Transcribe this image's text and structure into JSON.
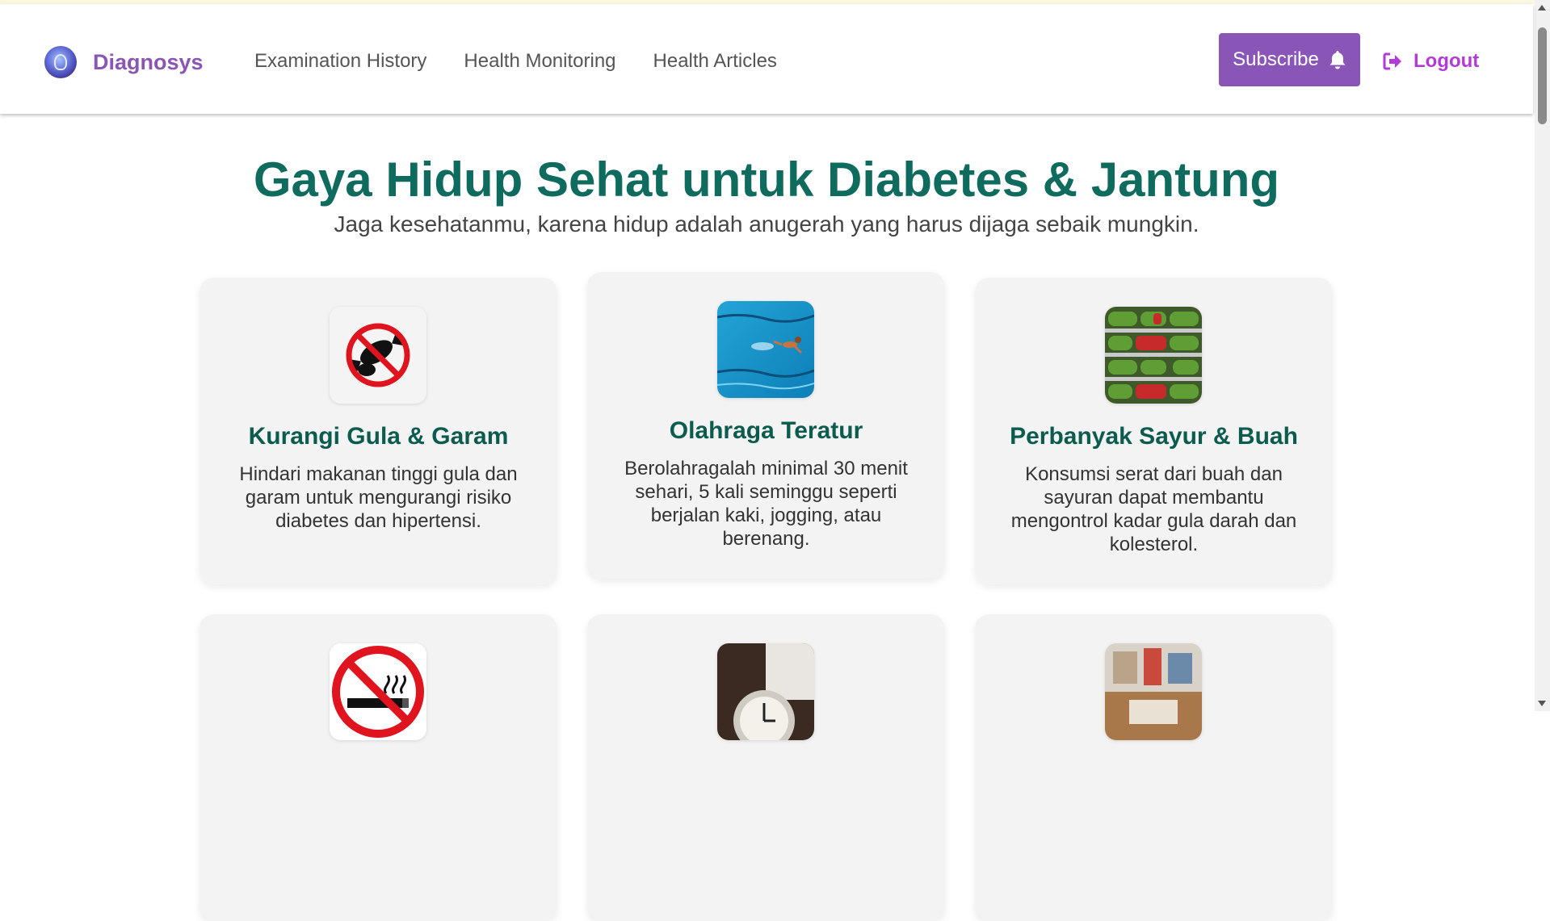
{
  "navbar": {
    "brand": "Diagnosys",
    "links": [
      "Examination History",
      "Health Monitoring",
      "Health Articles"
    ],
    "subscribe_label": "Subscribe",
    "logout_label": "Logout"
  },
  "hero": {
    "title": "Gaya Hidup Sehat untuk Diabetes & Jantung",
    "subtitle": "Jaga kesehatanmu, karena hidup adalah anugerah yang harus dijaga sebaik mungkin."
  },
  "cards": [
    {
      "icon": "no-candy-icon",
      "title": "Kurangi Gula & Garam",
      "text": "Hindari makanan tinggi gula dan garam untuk mengurangi risiko diabetes dan hipertensi."
    },
    {
      "icon": "swimming-photo",
      "title": "Olahraga Teratur",
      "text": "Berolahragalah minimal 30 menit sehari, 5 kali seminggu seperti berjalan kaki, jogging, atau berenang."
    },
    {
      "icon": "vegetables-photo",
      "title": "Perbanyak Sayur & Buah",
      "text": "Konsumsi serat dari buah dan sayuran dapat membantu mengontrol kadar gula darah dan kolesterol."
    },
    {
      "icon": "no-smoking-icon"
    },
    {
      "icon": "alarm-clock-photo"
    },
    {
      "icon": "desk-photo"
    }
  ],
  "colors": {
    "brand": "#8a55b5",
    "title_green": "#0e6b5e",
    "subscribe_bg": "#8956b8",
    "logout": "#b23bd8",
    "card_bg": "#f3f3f3"
  }
}
